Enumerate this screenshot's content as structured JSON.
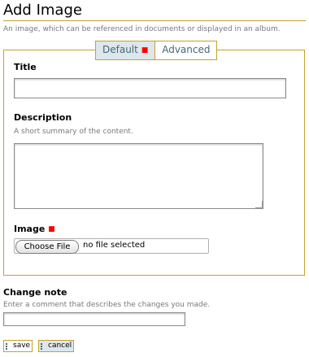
{
  "page": {
    "title": "Add Image",
    "description": "An image, which can be referenced in documents or displayed in an album."
  },
  "tabs": [
    {
      "label": "Default",
      "selected": true,
      "required_marker": "■"
    },
    {
      "label": "Advanced",
      "selected": false
    }
  ],
  "fields": {
    "title": {
      "label": "Title",
      "value": ""
    },
    "description": {
      "label": "Description",
      "help": "A short summary of the content.",
      "value": ""
    },
    "image": {
      "label": "Image",
      "required_marker": "■",
      "button_label": "Choose File",
      "status": "no file selected"
    }
  },
  "change_note": {
    "label": "Change note",
    "help": "Enter a comment that describes the changes you made.",
    "value": ""
  },
  "buttons": {
    "save": "save",
    "cancel": "cancel"
  },
  "colors": {
    "accent_border": "#c8a02c",
    "selected_tab_bg": "#dee7ec",
    "required": "#ff0000",
    "help_text": "#76797c"
  }
}
